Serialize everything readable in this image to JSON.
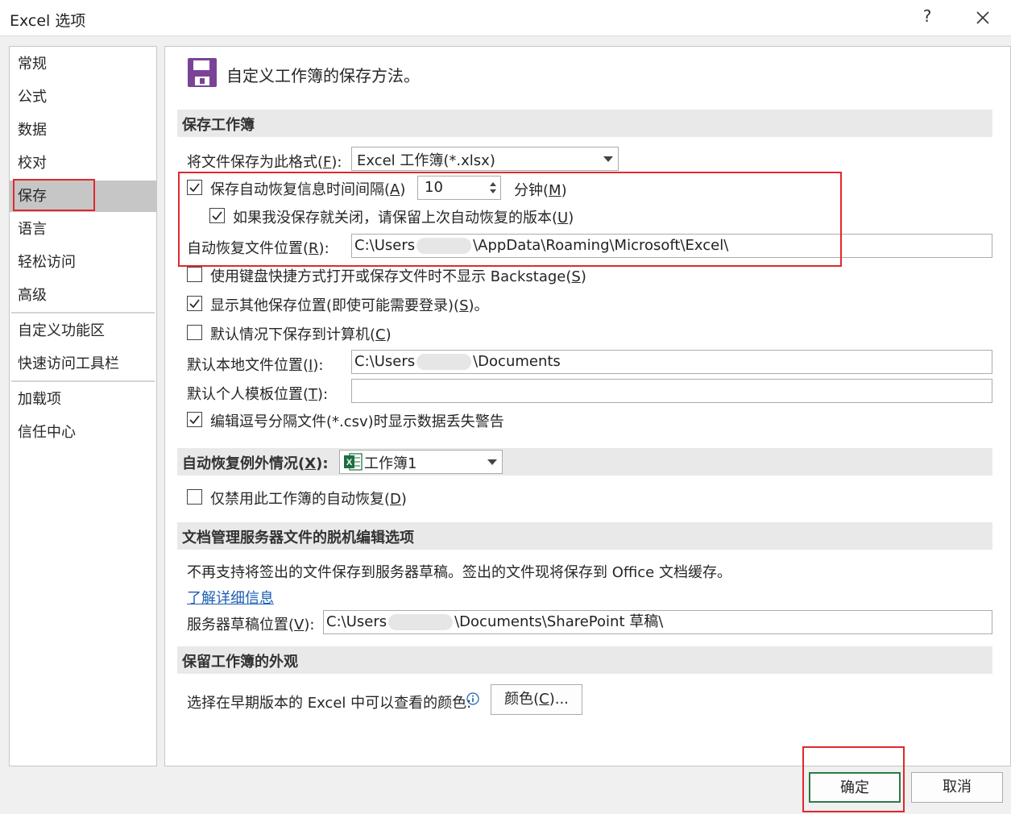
{
  "window": {
    "title": "Excel 选项",
    "help_label": "?"
  },
  "sidebar": {
    "items": [
      {
        "label": "常规"
      },
      {
        "label": "公式"
      },
      {
        "label": "数据"
      },
      {
        "label": "校对"
      },
      {
        "label": "保存"
      },
      {
        "label": "语言"
      },
      {
        "label": "轻松访问"
      },
      {
        "label": "高级"
      },
      {
        "label": "自定义功能区"
      },
      {
        "label": "快速访问工具栏"
      },
      {
        "label": "加载项"
      },
      {
        "label": "信任中心"
      }
    ],
    "selected": "保存"
  },
  "page": {
    "heading": "自定义工作簿的保存方法。",
    "icon": "floppy-disk-icon",
    "accent": "#7b4397"
  },
  "save_workbooks": {
    "header": "保存工作簿",
    "format_label": "将文件保存为此格式(",
    "format_key": "F",
    "format_tail": "):",
    "format_value": "Excel 工作簿(*.xlsx)",
    "autorecover_label": "保存自动恢复信息时间间隔(",
    "autorecover_key": "A",
    "autorecover_tail": ")",
    "autorecover_checked": true,
    "interval_value": "10",
    "minutes_label": "分钟(",
    "minutes_key": "M",
    "minutes_tail": ")",
    "keep_last_label": "如果我没保存就关闭，请保留上次自动恢复的版本(",
    "keep_last_key": "U",
    "keep_last_tail": ")",
    "keep_last_checked": true,
    "ar_location_label": "自动恢复文件位置(",
    "ar_location_key": "R",
    "ar_location_tail": "):",
    "ar_location_prefix": "C:\\Users",
    "ar_location_suffix": "\\AppData\\Roaming\\Microsoft\\Excel\\",
    "no_backstage_label": "使用键盘快捷方式打开或保存文件时不显示 Backstage(",
    "no_backstage_key": "S",
    "no_backstage_tail": ")",
    "no_backstage_checked": false,
    "show_other_label": "显示其他保存位置(即使可能需要登录)(",
    "show_other_key": "S",
    "show_other_tail": ")。",
    "show_other_checked": true,
    "save_computer_label": "默认情况下保存到计算机(",
    "save_computer_key": "C",
    "save_computer_tail": ")",
    "save_computer_checked": false,
    "local_location_label": "默认本地文件位置(",
    "local_location_key": "I",
    "local_location_tail": "):",
    "local_location_prefix": "C:\\Users",
    "local_location_suffix": "\\Documents",
    "template_location_label": "默认个人模板位置(",
    "template_location_key": "T",
    "template_location_tail": "):",
    "template_location_value": "",
    "csv_warning_label": "编辑逗号分隔文件(*.csv)时显示数据丢失警告",
    "csv_warning_checked": true
  },
  "autorecover_exceptions": {
    "header_label": "自动恢复例外情况(",
    "header_key": "X",
    "header_tail": "):",
    "workbook_value": "工作簿1",
    "workbook_icon": "excel-file-icon",
    "disable_label": "仅禁用此工作簿的自动恢复(",
    "disable_key": "D",
    "disable_tail": ")",
    "disable_checked": false
  },
  "offline_editing": {
    "header": "文档管理服务器文件的脱机编辑选项",
    "notice": "不再支持将签出的文件保存到服务器草稿。签出的文件现将保存到 Office 文档缓存。",
    "learn_more": "了解详细信息",
    "drafts_label": "服务器草稿位置(",
    "drafts_key": "V",
    "drafts_tail": "):",
    "drafts_prefix": "C:\\Users",
    "drafts_suffix": "\\Documents\\SharePoint 草稿\\"
  },
  "appearance": {
    "header": "保留工作簿的外观",
    "colors_prompt": "选择在早期版本的 Excel 中可以查看的颜色:",
    "info_icon": "info-icon",
    "colors_button_label": "颜色(",
    "colors_button_key": "C",
    "colors_button_tail": ")..."
  },
  "footer": {
    "ok": "确定",
    "cancel": "取消"
  },
  "colors": {
    "highlight": "#e0282e",
    "selected_nav": "#c6c6c6",
    "ok_border": "#2d7a46",
    "excel_green": "#1d6f42"
  }
}
